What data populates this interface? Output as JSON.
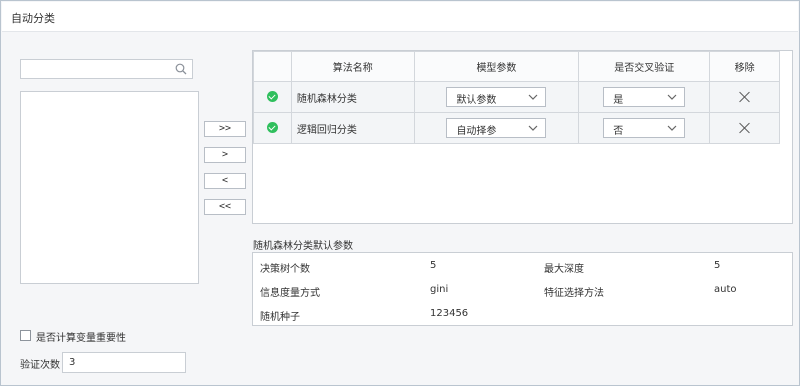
{
  "title": "自动分类",
  "transfer_buttons": [
    ">>",
    ">",
    "<",
    "<<"
  ],
  "table": {
    "headers": [
      "算法名称",
      "模型参数",
      "是否交叉验证",
      "移除"
    ],
    "rows": [
      {
        "name": "随机森林分类",
        "param": "默认参数",
        "cv": "是"
      },
      {
        "name": "逻辑回归分类",
        "param": "自动择参",
        "cv": "否"
      }
    ]
  },
  "params": {
    "title": "随机森林分类默认参数",
    "items": [
      {
        "label": "决策树个数",
        "value": "5"
      },
      {
        "label": "最大深度",
        "value": "5"
      },
      {
        "label": "信息度量方式",
        "value": "gini"
      },
      {
        "label": "特征选择方法",
        "value": "auto"
      },
      {
        "label": "随机种子",
        "value": "123456"
      }
    ]
  },
  "options": {
    "importance_label": "是否计算变量重要性",
    "importance_checked": false,
    "validation_label": "验证次数",
    "validation_value": "3"
  },
  "icons": {
    "search": "search-icon",
    "check": "check-circle-icon",
    "remove": "close-icon",
    "dropdown": "chevron-down-icon"
  },
  "colors": {
    "check": "#2fbf5d",
    "border": "#c9ced4",
    "panel": "#f5f6f8"
  }
}
